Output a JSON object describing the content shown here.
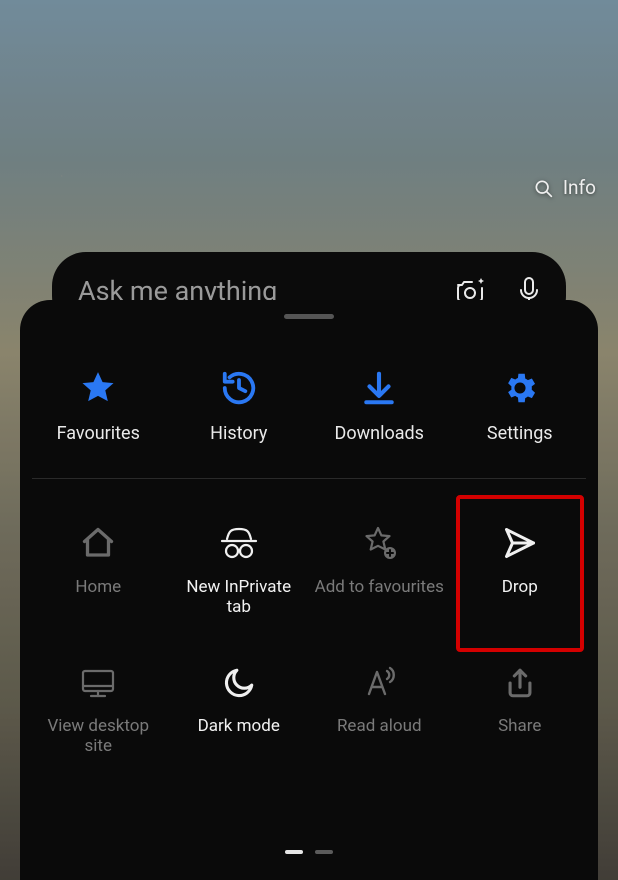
{
  "top_right": {
    "info_label": "Info"
  },
  "ask_bar": {
    "placeholder": "Ask me anything"
  },
  "panel": {
    "primary": [
      {
        "label": "Favourites",
        "icon": "star-icon",
        "accent": "#2a78f3"
      },
      {
        "label": "History",
        "icon": "history-icon",
        "accent": "#2a78f3"
      },
      {
        "label": "Downloads",
        "icon": "download-icon",
        "accent": "#2a78f3"
      },
      {
        "label": "Settings",
        "icon": "gear-icon",
        "accent": "#2a78f3"
      }
    ],
    "grid": [
      {
        "label": "Home",
        "icon": "home-icon",
        "state": "dim"
      },
      {
        "label": "New InPrivate tab",
        "icon": "incognito-icon",
        "state": "bright"
      },
      {
        "label": "Add to favourites",
        "icon": "star-add-icon",
        "state": "dim"
      },
      {
        "label": "Drop",
        "icon": "send-icon",
        "state": "bright",
        "highlighted": true
      },
      {
        "label": "View desktop site",
        "icon": "desktop-icon",
        "state": "dim"
      },
      {
        "label": "Dark mode",
        "icon": "moon-icon",
        "state": "bright"
      },
      {
        "label": "Read aloud",
        "icon": "read-aloud-icon",
        "state": "dim"
      },
      {
        "label": "Share",
        "icon": "share-icon",
        "state": "dim"
      }
    ],
    "highlight_color": "#d40000",
    "pager": {
      "total": 2,
      "active_index": 0
    }
  }
}
